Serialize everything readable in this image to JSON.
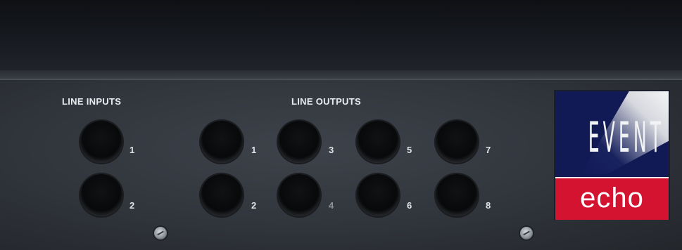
{
  "panel": {
    "inputs_label": "LINE INPUTS",
    "outputs_label": "LINE OUTPUTS"
  },
  "jacks": {
    "inputs": [
      "1",
      "2"
    ],
    "outputs": [
      "1",
      "2",
      "3",
      "4",
      "5",
      "6",
      "7",
      "8"
    ]
  },
  "logo": {
    "top_text": "EVENT",
    "bottom_text": "echo",
    "colors": {
      "navy": "#111a55",
      "red": "#d3132f"
    }
  }
}
